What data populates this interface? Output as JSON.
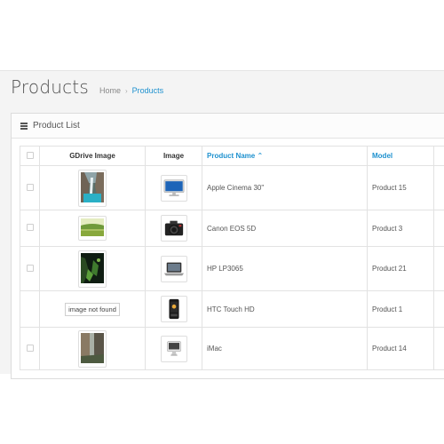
{
  "header": {
    "title": "Products",
    "breadcrumb": [
      {
        "label": "Home"
      },
      {
        "label": "Products"
      }
    ]
  },
  "panel": {
    "title": "Product List"
  },
  "table": {
    "columns": {
      "gdrive_image": "GDrive Image",
      "image": "Image",
      "product_name": "Product Name",
      "model": "Model"
    },
    "sort_indicator": "⌃",
    "rows": [
      {
        "gdrive": "waterfall photo",
        "image": "monitor",
        "name": "Apple Cinema 30\"",
        "model": "Product 15"
      },
      {
        "gdrive": "meadow photo",
        "image": "camera",
        "name": "Canon EOS 5D",
        "model": "Product 3"
      },
      {
        "gdrive": "forest photo",
        "image": "laptop",
        "name": "HP LP3065",
        "model": "Product 21"
      },
      {
        "gdrive_text": "image not found",
        "image": "phone",
        "name": "HTC Touch HD",
        "model": "Product 1"
      },
      {
        "gdrive": "canyon photo",
        "image": "imac",
        "name": "iMac",
        "model": "Product 14"
      }
    ]
  },
  "colors": {
    "link": "#1e91cf",
    "page_bg": "#f4f4f4"
  }
}
